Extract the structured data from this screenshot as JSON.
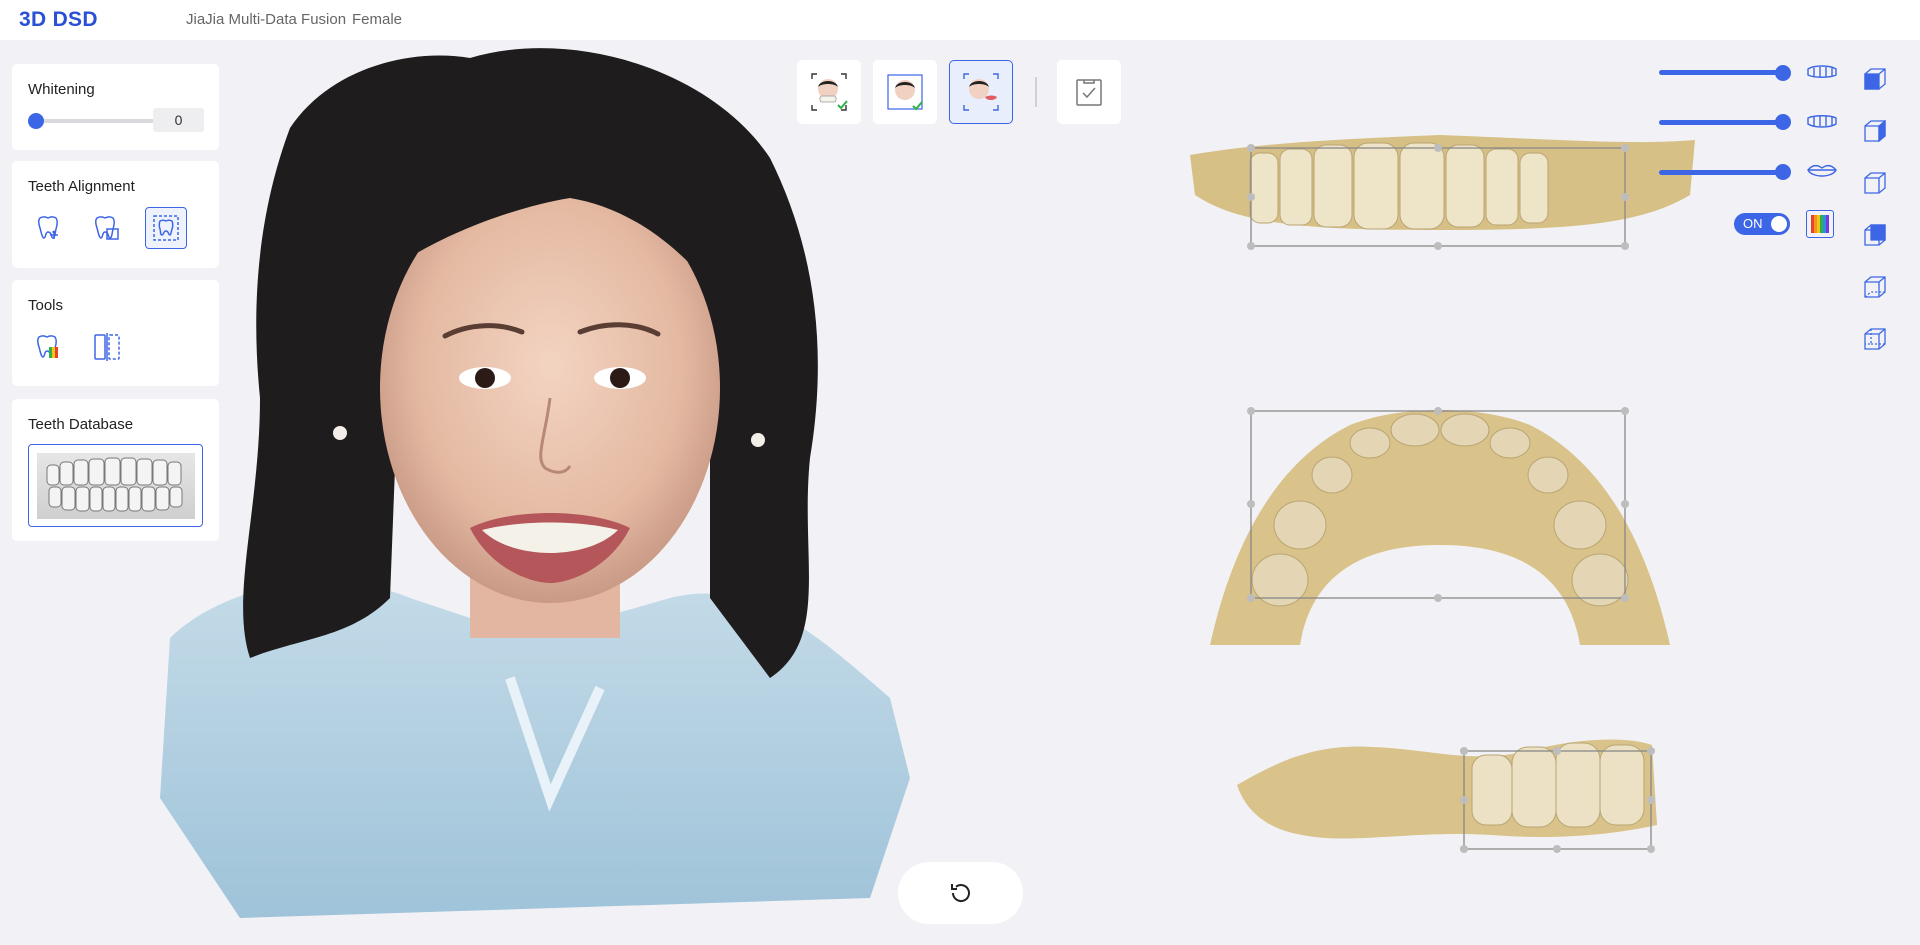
{
  "header": {
    "brand": "3D DSD",
    "project": "JiaJia Multi-Data Fusion",
    "gender": "Female"
  },
  "whitening": {
    "title": "Whitening",
    "value": "0",
    "level": 0
  },
  "teeth_alignment": {
    "title": "Teeth Alignment",
    "tools": [
      {
        "icon": "tooth-move-icon",
        "active": false
      },
      {
        "icon": "tooth-copy-icon",
        "active": false
      },
      {
        "icon": "tooth-frame-icon",
        "active": true
      }
    ]
  },
  "tools": {
    "title": "Tools",
    "items": [
      {
        "icon": "tooth-color-map-icon"
      },
      {
        "icon": "mirror-split-icon"
      }
    ]
  },
  "teeth_database": {
    "title": "Teeth Database"
  },
  "modes": [
    {
      "icon": "face-teeth-fusion-icon",
      "active": false
    },
    {
      "icon": "face-scan-check-icon",
      "active": false
    },
    {
      "icon": "face-smile-design-icon",
      "active": true
    }
  ],
  "confirm": {
    "icon": "clipboard-check-icon"
  },
  "right_panel": {
    "sliders": [
      {
        "icon": "upper-jaw-icon",
        "level": 1
      },
      {
        "icon": "lower-jaw-icon",
        "level": 1
      },
      {
        "icon": "lips-icon",
        "level": 1
      }
    ],
    "toggle_label": "ON",
    "colors": {
      "accent": "#3d66e6",
      "tooth": "#d9c38a",
      "background": "#f2f2f6"
    }
  },
  "view_cubes": [
    {
      "icon": "view-front-icon"
    },
    {
      "icon": "view-right-icon"
    },
    {
      "icon": "view-left-icon"
    },
    {
      "icon": "view-top-icon"
    },
    {
      "icon": "view-bottom-icon"
    },
    {
      "icon": "view-back-icon"
    }
  ],
  "undo": {
    "icon": "reset-icon"
  }
}
